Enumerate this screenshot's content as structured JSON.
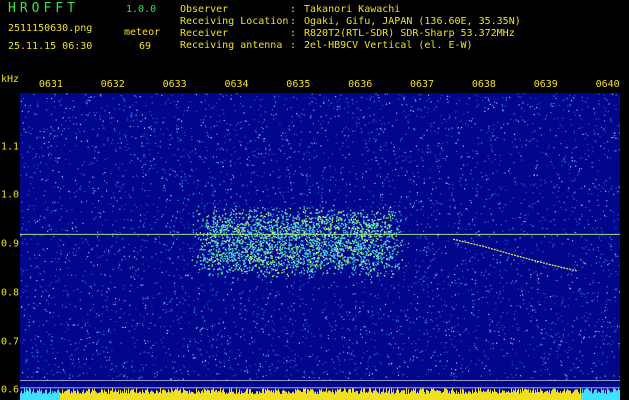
{
  "header": {
    "app_title": "HROFFT",
    "app_version": "1.0.0",
    "file_name": "2511150630.png",
    "timestamp": "25.11.15 06:30",
    "meteor_label": "meteor",
    "meteor_count": "69",
    "meta": [
      {
        "label": "Observer",
        "value": "Takanori Kawachi"
      },
      {
        "label": "Receiving Location",
        "value": "Ogaki, Gifu, JAPAN (136.60E, 35.35N)"
      },
      {
        "label": "Receiver",
        "value": "R820T2(RTL-SDR) SDR-Sharp 53.372MHz"
      },
      {
        "label": "Receiving antenna",
        "value": "2el-HB9CV Vertical (el. E-W)"
      }
    ],
    "separator": ":"
  },
  "colors": {
    "background": "#000000",
    "plot_background": "#02068a",
    "title_green": "#2ee84a",
    "tick_yellow": "#f0e020",
    "noise_light": "#4aa8ff",
    "carrier": "#f0e020"
  },
  "chart_data": {
    "type": "heatmap",
    "title": "",
    "x_unit": "",
    "y_unit": "kHz",
    "x_ticks": [
      "0631",
      "0632",
      "0633",
      "0634",
      "0635",
      "0636",
      "0637",
      "0638",
      "0639",
      "0640"
    ],
    "y_ticks": [
      "1.1",
      "1.0",
      "0.9",
      "0.8",
      "0.7",
      "0.6"
    ],
    "y_tick_values": [
      1.1,
      1.0,
      0.9,
      0.8,
      0.7,
      0.6
    ],
    "y_range": [
      0.58,
      1.21
    ],
    "x_range_minutes": [
      6.5,
      16.2
    ],
    "carrier_khz": 0.92,
    "lower_reference_khz": [
      0.62,
      0.605
    ],
    "bright_band": {
      "x_start_min": 9.5,
      "x_end_min": 12.5,
      "y_low_khz": 0.85,
      "y_high_khz": 0.96
    },
    "meteor_trail": [
      {
        "x_min": 13.5,
        "y_khz": 0.91
      },
      {
        "x_min": 14.0,
        "y_khz": 0.895
      },
      {
        "x_min": 14.5,
        "y_khz": 0.877
      },
      {
        "x_min": 15.0,
        "y_khz": 0.86
      },
      {
        "x_min": 15.5,
        "y_khz": 0.845
      }
    ]
  }
}
